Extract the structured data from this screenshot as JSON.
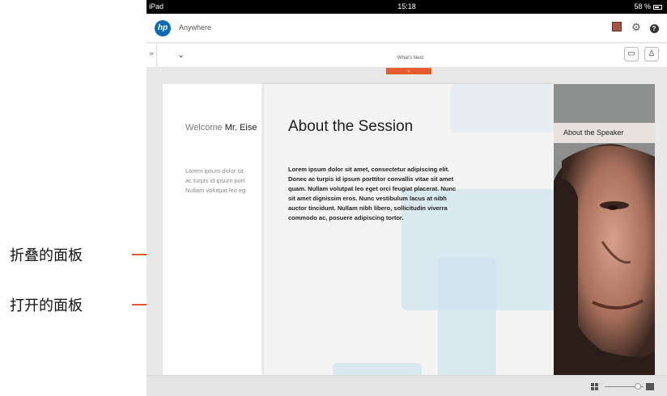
{
  "status_bar": {
    "device": "iPad",
    "time": "15:18",
    "battery": "58 %"
  },
  "app_bar": {
    "logo": "hp",
    "title": "Anywhere",
    "icons": [
      "avatar",
      "gear-icon",
      "help-icon"
    ]
  },
  "toolbar": {
    "expand_glyph": "»",
    "dropdown_glyph": "⌄",
    "whats_next_label": "What's Next",
    "whats_next_arrow": "⌄",
    "buttons": [
      "comment-icon",
      "presenter-icon"
    ]
  },
  "collapsed_panel": {
    "welcome_prefix": "Welcome",
    "welcome_name": "Mr. Eise",
    "lorem_lines": [
      "Lorem ipsum dolor sit",
      "ac turpis id ipsum port",
      "Nullam volutpat leo eg"
    ]
  },
  "open_panel": {
    "title": "About the Session",
    "body": "Lorem ipsum dolor sit amet, consectetur adipiscing elit. Donec ac turpis id ipsum porttitor convallis vitae sit amet quam. Nullam volutpat leo eget orci feugiat placerat. Nunc sit amet dignissim eros. Nunc vestibulum lacus at nibh auctor tincidunt. Nullam nibh libero, sollicitudin viverra commodo ac, posuere adipiscing tortor."
  },
  "speaker_panel": {
    "label": "About the Speaker"
  },
  "annotations": {
    "collapsed": "折叠的面板",
    "opened": "打开的面板",
    "accent_color": "#e8552e"
  },
  "colors": {
    "hp_blue": "#0a6bb3",
    "accent": "#e95a2f"
  }
}
